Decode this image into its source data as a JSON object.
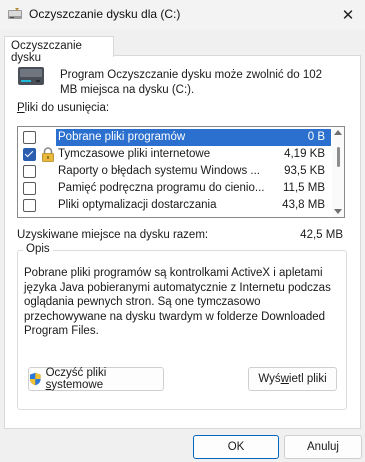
{
  "window": {
    "title": "Oczyszczanie dysku dla  (C:)",
    "close_glyph": "✕"
  },
  "tab": {
    "label": "Oczyszczanie dysku"
  },
  "intro": {
    "text": "Program Oczyszczanie dysku może zwolnić do 102 MB miejsca na dysku  (C:)."
  },
  "files_to_delete": {
    "label": "Pliki do usunięcia:",
    "items": [
      {
        "name": "Pobrane pliki programów",
        "size": "0 B",
        "checked": false,
        "selected": true,
        "icon": "none"
      },
      {
        "name": "Tymczasowe pliki internetowe",
        "size": "4,19 KB",
        "checked": true,
        "selected": false,
        "icon": "lock-icon"
      },
      {
        "name": "Raporty o błędach systemu Windows ...",
        "size": "93,5 KB",
        "checked": false,
        "selected": false,
        "icon": "none"
      },
      {
        "name": "Pamięć podręczna programu do cienio...",
        "size": "11,5 MB",
        "checked": false,
        "selected": false,
        "icon": "none"
      },
      {
        "name": "Pliki optymalizacji dostarczania",
        "size": "43,8 MB",
        "checked": false,
        "selected": false,
        "icon": "none"
      }
    ]
  },
  "space_gained": {
    "label": "Uzyskiwane miejsce na dysku razem:",
    "value": "42,5 MB"
  },
  "description": {
    "title": "Opis",
    "text": "Pobrane pliki programów są kontrolkami ActiveX i apletami języka Java pobieranymi automatycznie z Internetu podczas oglądania pewnych stron. Są one tymczasowo przechowywane na dysku twardym w folderze Downloaded Program Files."
  },
  "buttons": {
    "clean_system": "Oczyść pliki systemowe",
    "view_files": "Wyświetl pliki",
    "ok": "OK",
    "cancel": "Anuluj"
  },
  "colors": {
    "accent": "#0067c0",
    "selection": "#2b6fcf",
    "checkbox": "#2a5db0"
  }
}
